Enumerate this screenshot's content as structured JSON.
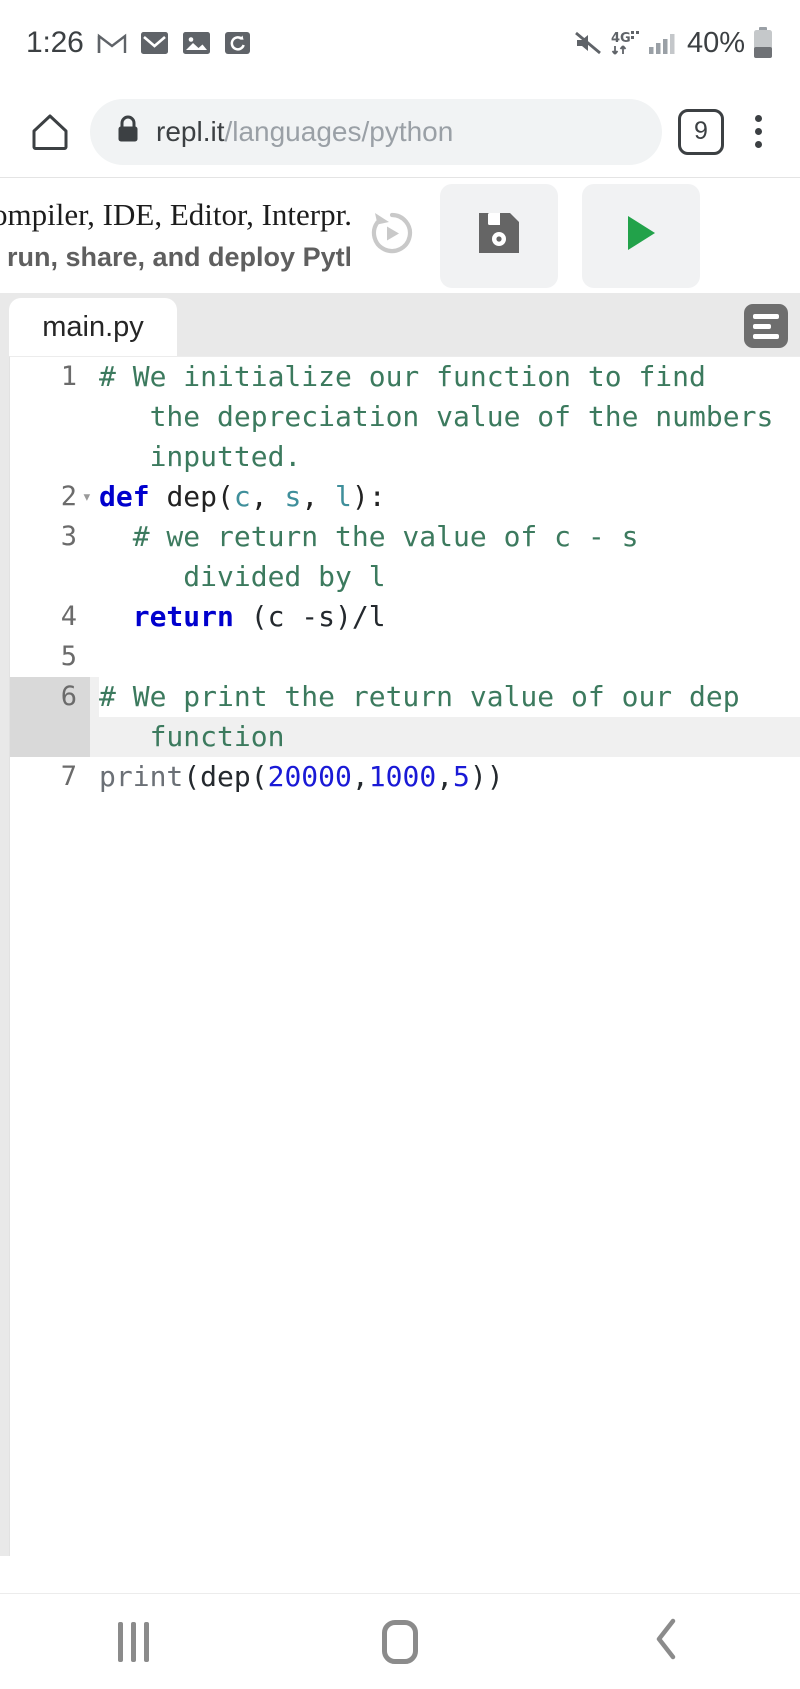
{
  "statusbar": {
    "time": "1:26",
    "left_icons": [
      "gmail-icon",
      "mail-icon",
      "photos-icon",
      "alarm-icon"
    ],
    "right_icons": [
      "mute-icon",
      "network-4g-plus-icon",
      "signal-bars-icon"
    ],
    "network_label": "4G",
    "battery_percent": "40%"
  },
  "browser": {
    "home_icon": "home-icon",
    "lock_icon": "lock-icon",
    "url_domain": "repl.it",
    "url_path": "/languages/python",
    "tab_count": "9",
    "menu_icon": "kebab-menu-icon"
  },
  "page_header": {
    "title_line": "ompiler, IDE, Editor, Interpr...",
    "subtitle_line": ", run, share, and deploy Pytho...",
    "history_icon": "history-revert-icon",
    "save_icon": "floppy-save-icon",
    "run_icon": "play-run-icon",
    "run_color": "#22a24a"
  },
  "editor": {
    "tab_label": "main.py",
    "format_icon": "format-lines-icon",
    "active_line": 6,
    "lines": [
      {
        "num": "1",
        "fold": false,
        "rows": [
          [
            {
              "t": "# We initialize our function to find",
              "c": "cm"
            }
          ],
          [
            {
              "t": "   the depreciation value of the numbers",
              "c": "cm"
            }
          ],
          [
            {
              "t": "   inputted.",
              "c": "cm"
            }
          ]
        ]
      },
      {
        "num": "2",
        "fold": true,
        "rows": [
          [
            {
              "t": "def ",
              "c": "kw"
            },
            {
              "t": "dep(",
              "c": "fn"
            },
            {
              "t": "c",
              "c": "arg"
            },
            {
              "t": ", ",
              "c": "fn"
            },
            {
              "t": "s",
              "c": "arg"
            },
            {
              "t": ", ",
              "c": "fn"
            },
            {
              "t": "l",
              "c": "arg"
            },
            {
              "t": "):",
              "c": "fn"
            }
          ]
        ]
      },
      {
        "num": "3",
        "fold": false,
        "rows": [
          [
            {
              "t": "  # we return the value of c - s",
              "c": "cm"
            }
          ],
          [
            {
              "t": "     divided by l",
              "c": "cm"
            }
          ]
        ]
      },
      {
        "num": "4",
        "fold": false,
        "rows": [
          [
            {
              "t": "  ",
              "c": "pl"
            },
            {
              "t": "return",
              "c": "kw"
            },
            {
              "t": " (c -s)/l",
              "c": "pl"
            }
          ]
        ]
      },
      {
        "num": "5",
        "fold": false,
        "rows": [
          [
            {
              "t": "",
              "c": "pl"
            }
          ]
        ]
      },
      {
        "num": "6",
        "fold": false,
        "rows": [
          [
            {
              "t": "# We print the return value of our dep",
              "c": "cm"
            }
          ],
          [
            {
              "t": "   function",
              "c": "cm"
            }
          ]
        ]
      },
      {
        "num": "7",
        "fold": false,
        "rows": [
          [
            {
              "t": "print",
              "c": "bi"
            },
            {
              "t": "(dep(",
              "c": "pl"
            },
            {
              "t": "20000",
              "c": "num"
            },
            {
              "t": ",",
              "c": "pl"
            },
            {
              "t": "1000",
              "c": "num"
            },
            {
              "t": ",",
              "c": "pl"
            },
            {
              "t": "5",
              "c": "num"
            },
            {
              "t": "))",
              "c": "pl"
            }
          ]
        ]
      }
    ]
  },
  "navbar": {
    "recents_icon": "recents-icon",
    "home_icon": "home-square-icon",
    "back_icon": "back-chevron-icon"
  }
}
